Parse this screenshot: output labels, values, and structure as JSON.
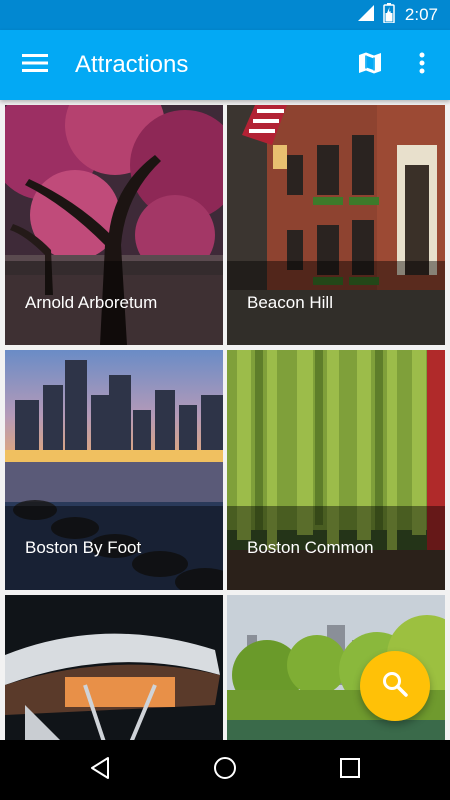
{
  "status_bar": {
    "time": "2:07",
    "icons": [
      "signal-icon",
      "battery-icon"
    ]
  },
  "app_bar": {
    "title": "Attractions",
    "icons": [
      "menu-icon",
      "map-icon",
      "more-vert-icon"
    ]
  },
  "attractions": [
    {
      "name": "Arnold Arboretum"
    },
    {
      "name": "Beacon Hill"
    },
    {
      "name": "Boston By Foot"
    },
    {
      "name": "Boston Common"
    },
    {
      "name": ""
    },
    {
      "name": ""
    }
  ],
  "fab": {
    "icon": "search-icon"
  },
  "nav_bar": {
    "icons": [
      "back-icon",
      "home-icon",
      "recents-icon"
    ]
  },
  "colors": {
    "status_bar": "#0288d1",
    "app_bar": "#03a9f4",
    "fab": "#ffc107",
    "nav_bar": "#000000"
  }
}
